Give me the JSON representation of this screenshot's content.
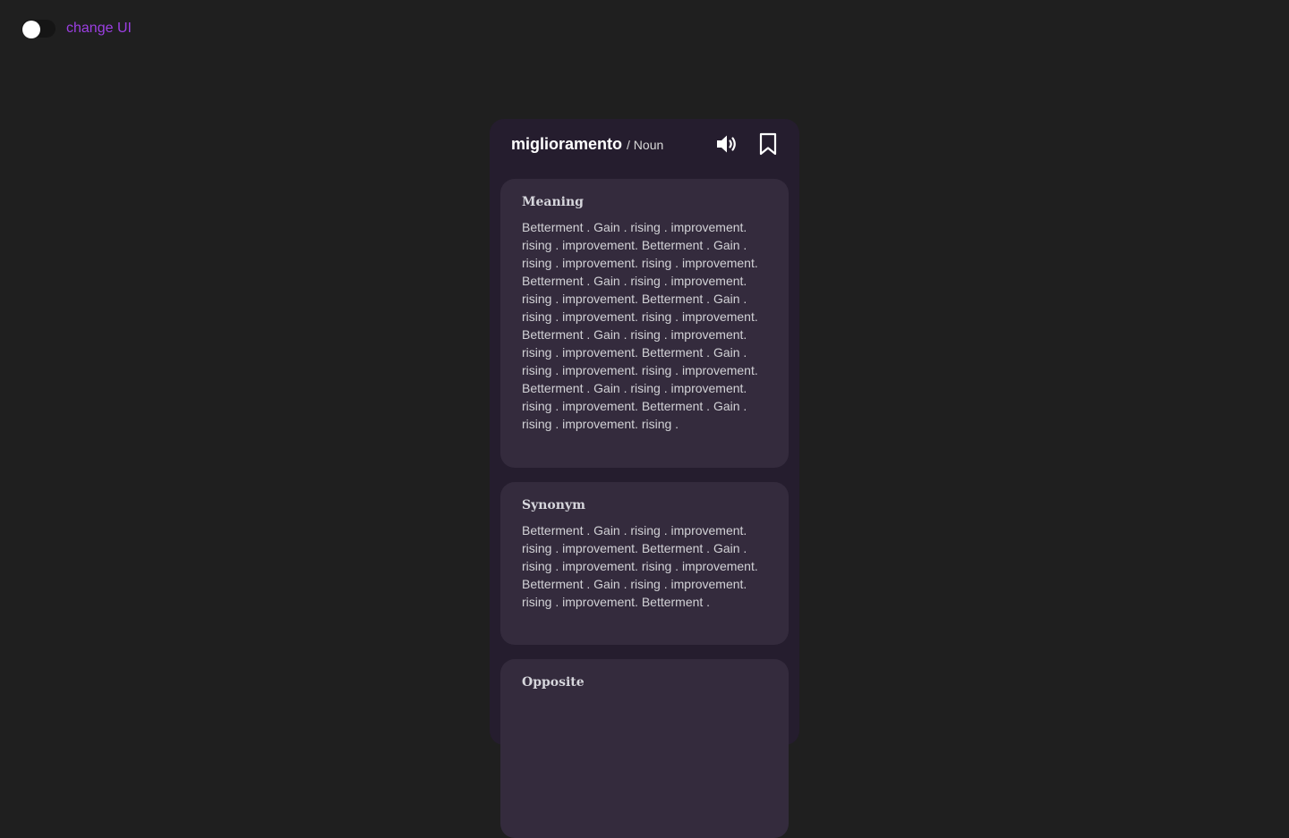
{
  "toggle": {
    "label": "change UI",
    "checked": false
  },
  "card": {
    "word": "miglioramento",
    "part_of_speech": "/ Noun",
    "icons": {
      "speak": "speaker-icon",
      "save": "bookmark-icon"
    },
    "sections": {
      "meaning": {
        "title": "Meaning",
        "body": "Betterment . Gain . rising . improvement. rising . improvement. Betterment . Gain . rising . improvement. rising . improvement. Betterment . Gain . rising . improvement. rising . improvement. Betterment . Gain . rising . improvement. rising . improvement. Betterment . Gain . rising . improvement. rising . improvement. Betterment . Gain . rising . improvement. rising . improvement. Betterment . Gain . rising . improvement. rising . improvement. Betterment . Gain . rising . improvement. rising ."
      },
      "synonym": {
        "title": "Synonym",
        "body": "Betterment . Gain . rising . improvement. rising . improvement. Betterment . Gain . rising . improvement. rising . improvement. Betterment . Gain . rising . improvement. rising . improvement. Betterment ."
      },
      "opposite": {
        "title": "Opposite"
      }
    }
  },
  "colors": {
    "page_background": "#1f1f1f",
    "accent": "#9c3fe3",
    "card_background": "#251d2e",
    "section_background": "#342b3d"
  }
}
